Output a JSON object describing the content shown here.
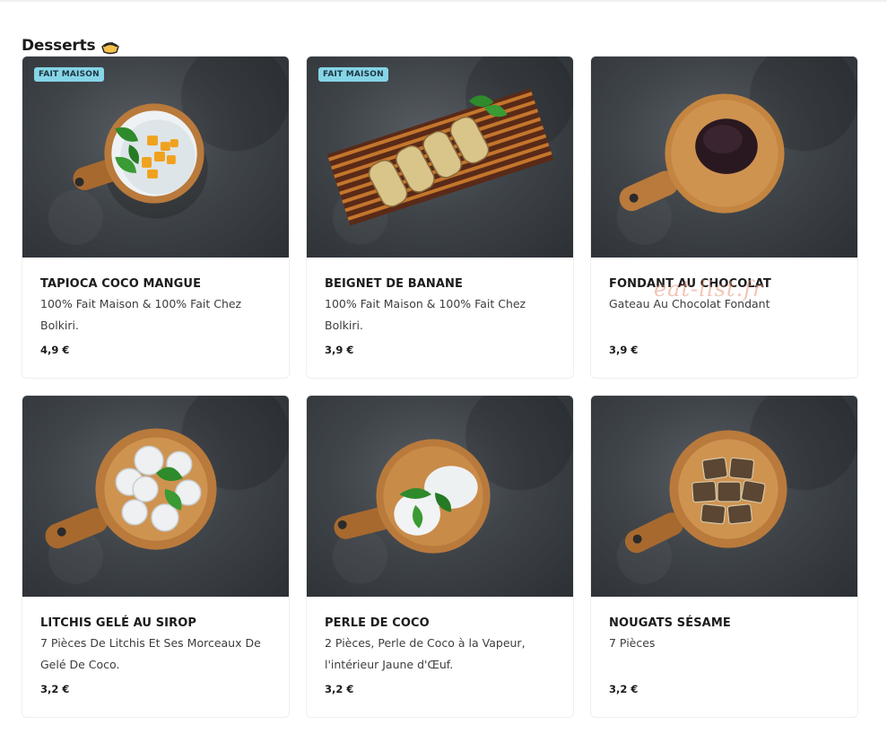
{
  "section": {
    "title": "Desserts",
    "icon": "pie-icon"
  },
  "items": [
    {
      "name": "TAPIOCA COCO MANGUE",
      "desc": "100% Fait Maison & 100% Fait Chez Bolkiri.",
      "price": "4,9 €",
      "badge": "FAIT MAISON",
      "image": "tapioca-bowl"
    },
    {
      "name": "BEIGNET DE BANANE",
      "desc": "100% Fait Maison & 100% Fait Chez Bolkiri.",
      "price": "3,9 €",
      "badge": "FAIT MAISON",
      "image": "banana-fritters"
    },
    {
      "name": "FONDANT AU CHOCOLAT",
      "desc": "Gateau Au Chocolat Fondant",
      "price": "3,9 €",
      "badge": "",
      "image": "chocolate-fondant"
    },
    {
      "name": "LITCHIS GELÉ AU SIROP",
      "desc": "7 Pièces De Litchis Et Ses Morceaux De Gelé De Coco.",
      "price": "3,2 €",
      "badge": "",
      "image": "litchi-bowl"
    },
    {
      "name": "PERLE DE COCO",
      "desc": "2 Pièces, Perle de Coco à la Vapeur, l'intérieur Jaune d'Œuf.",
      "price": "3,2 €",
      "badge": "",
      "image": "coconut-pearls"
    },
    {
      "name": "NOUGATS SÉSAME",
      "desc": "7 Pièces",
      "price": "3,2 €",
      "badge": "",
      "image": "sesame-nougats"
    }
  ],
  "watermark": "eat-list.fr",
  "colors": {
    "badge": "#85d5e6",
    "background": "#ffffff",
    "photo": "#3f4449",
    "wood": "#b97a3c"
  }
}
